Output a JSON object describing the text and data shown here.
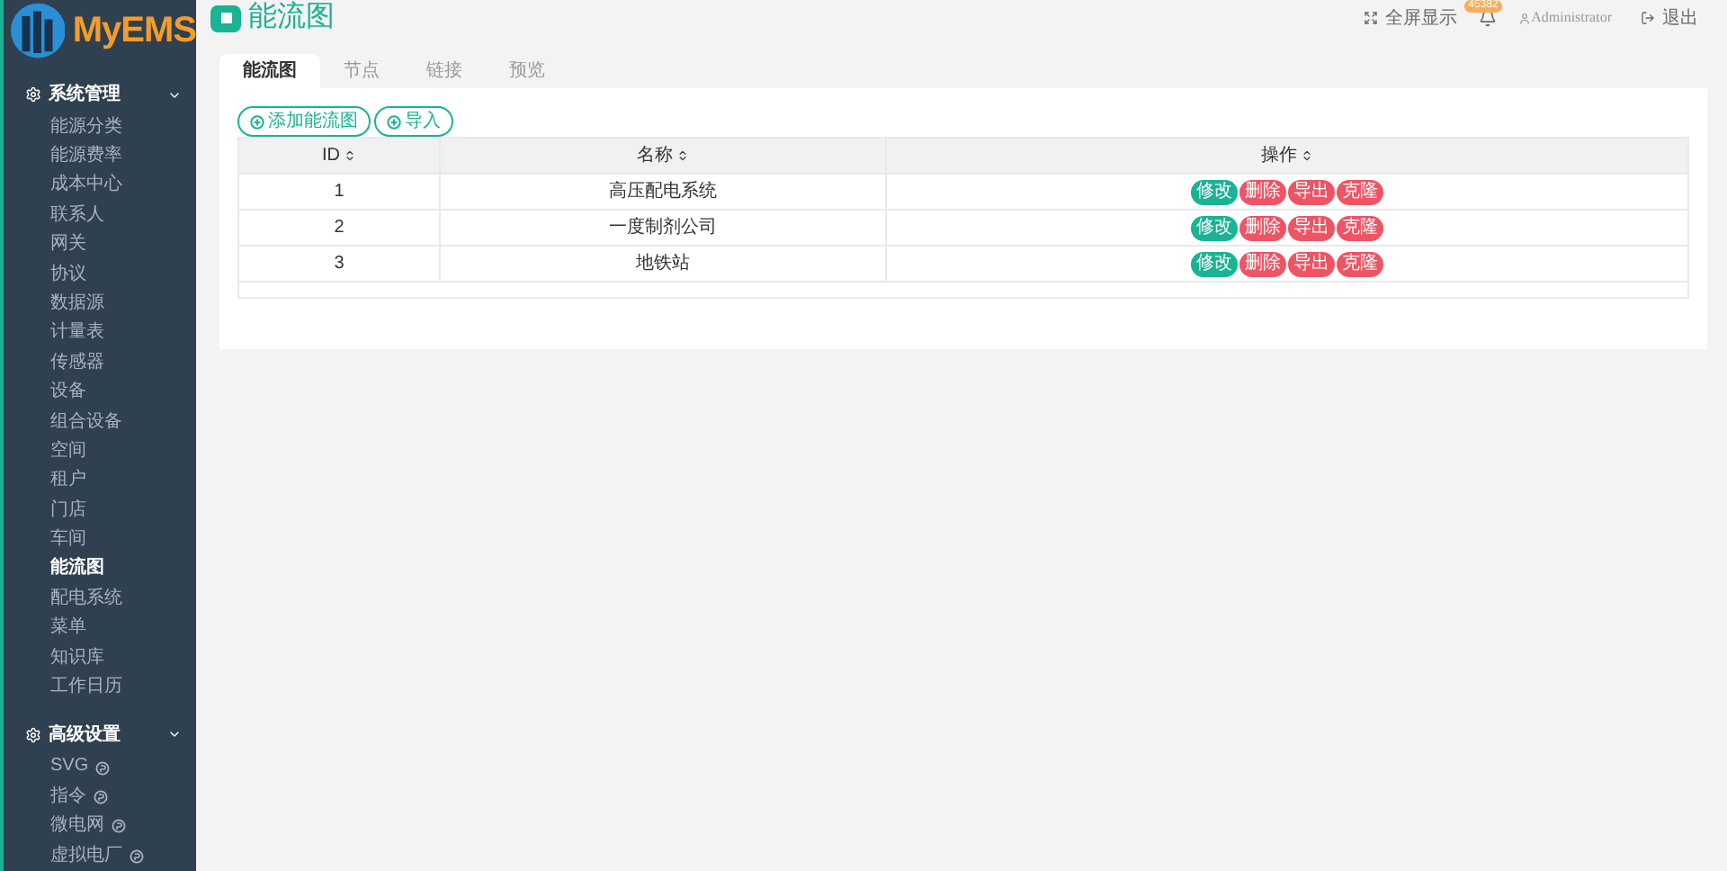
{
  "logo": {
    "text": "MyEMS"
  },
  "sidebar": {
    "groups": [
      {
        "label": "系统管理",
        "expanded": true,
        "items": [
          {
            "label": "能源分类",
            "selected": false,
            "pro": false
          },
          {
            "label": "能源费率",
            "selected": false,
            "pro": false
          },
          {
            "label": "成本中心",
            "selected": false,
            "pro": false
          },
          {
            "label": "联系人",
            "selected": false,
            "pro": false
          },
          {
            "label": "网关",
            "selected": false,
            "pro": false
          },
          {
            "label": "协议",
            "selected": false,
            "pro": false
          },
          {
            "label": "数据源",
            "selected": false,
            "pro": false
          },
          {
            "label": "计量表",
            "selected": false,
            "pro": false
          },
          {
            "label": "传感器",
            "selected": false,
            "pro": false
          },
          {
            "label": "设备",
            "selected": false,
            "pro": false
          },
          {
            "label": "组合设备",
            "selected": false,
            "pro": false
          },
          {
            "label": "空间",
            "selected": false,
            "pro": false
          },
          {
            "label": "租户",
            "selected": false,
            "pro": false
          },
          {
            "label": "门店",
            "selected": false,
            "pro": false
          },
          {
            "label": "车间",
            "selected": false,
            "pro": false
          },
          {
            "label": "能流图",
            "selected": true,
            "pro": false
          },
          {
            "label": "配电系统",
            "selected": false,
            "pro": false
          },
          {
            "label": "菜单",
            "selected": false,
            "pro": false
          },
          {
            "label": "知识库",
            "selected": false,
            "pro": false
          },
          {
            "label": "工作日历",
            "selected": false,
            "pro": false
          }
        ]
      },
      {
        "label": "高级设置",
        "expanded": true,
        "items": [
          {
            "label": "SVG",
            "selected": false,
            "pro": true
          },
          {
            "label": "指令",
            "selected": false,
            "pro": true
          },
          {
            "label": "微电网",
            "selected": false,
            "pro": true
          },
          {
            "label": "虚拟电厂",
            "selected": false,
            "pro": true
          }
        ]
      }
    ]
  },
  "page_title": "能流图",
  "topbar": {
    "fullscreen": "全屏显示",
    "notification_count": "45382",
    "user": "Administrator",
    "logout": "退出"
  },
  "tabs": [
    {
      "label": "能流图",
      "selected": true
    },
    {
      "label": "节点",
      "selected": false
    },
    {
      "label": "链接",
      "selected": false
    },
    {
      "label": "预览",
      "selected": false
    }
  ],
  "buttons": [
    "添加能流图",
    "导入"
  ],
  "table": {
    "columns": [
      "ID",
      "名称",
      "操作"
    ],
    "rows": [
      {
        "id": "1",
        "name": "高压配电系统",
        "actions": [
          {
            "label": "修改",
            "kind": "edit"
          },
          {
            "label": "删除",
            "kind": "danger"
          },
          {
            "label": "导出",
            "kind": "danger"
          },
          {
            "label": "克隆",
            "kind": "danger"
          }
        ]
      },
      {
        "id": "2",
        "name": "一度制剂公司",
        "actions": [
          {
            "label": "修改",
            "kind": "edit"
          },
          {
            "label": "删除",
            "kind": "danger"
          },
          {
            "label": "导出",
            "kind": "danger"
          },
          {
            "label": "克隆",
            "kind": "danger"
          }
        ]
      },
      {
        "id": "3",
        "name": "地铁站",
        "actions": [
          {
            "label": "修改",
            "kind": "edit"
          },
          {
            "label": "删除",
            "kind": "danger"
          },
          {
            "label": "导出",
            "kind": "danger"
          },
          {
            "label": "克隆",
            "kind": "danger"
          }
        ]
      }
    ]
  }
}
